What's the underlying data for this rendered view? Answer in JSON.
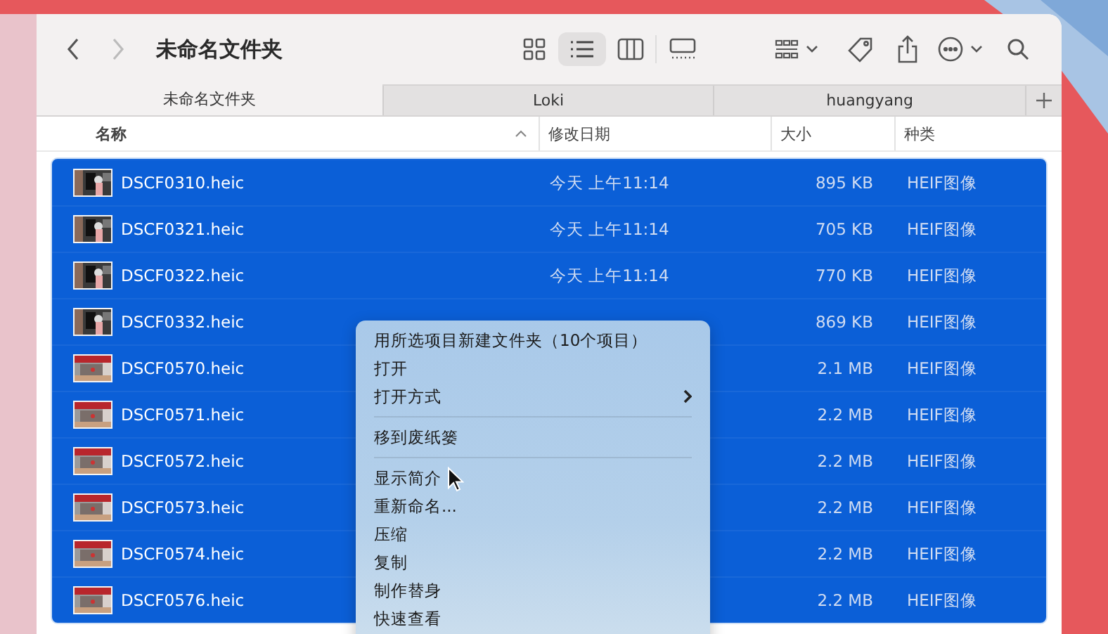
{
  "window": {
    "title": "未命名文件夹"
  },
  "navigation": {
    "back_disabled": false,
    "forward_disabled": true
  },
  "view_modes": [
    {
      "kind": "icons",
      "selected": false
    },
    {
      "kind": "list",
      "selected": true
    },
    {
      "kind": "columns",
      "selected": false
    },
    {
      "kind": "gallery",
      "selected": false
    }
  ],
  "tabs": [
    {
      "label": "未命名文件夹",
      "selected": true
    },
    {
      "label": "Loki",
      "selected": false
    },
    {
      "label": "huangyang",
      "selected": false
    }
  ],
  "columns": [
    {
      "label": "名称",
      "sorted": true
    },
    {
      "label": "修改日期",
      "sorted": false
    },
    {
      "label": "大小",
      "sorted": false
    },
    {
      "label": "种类",
      "sorted": false
    }
  ],
  "rows": [
    {
      "name": "DSCF0310.heic",
      "date": "今天 上午11:14",
      "size": "895 KB",
      "kind": "HEIF图像",
      "selected": true
    },
    {
      "name": "DSCF0321.heic",
      "date": "今天 上午11:14",
      "size": "705 KB",
      "kind": "HEIF图像",
      "selected": true
    },
    {
      "name": "DSCF0322.heic",
      "date": "今天 上午11:14",
      "size": "770 KB",
      "kind": "HEIF图像",
      "selected": true
    },
    {
      "name": "DSCF0332.heic",
      "size": "869 KB",
      "kind": "HEIF图像",
      "selected": true
    },
    {
      "name": "DSCF0570.heic",
      "size": "2.1 MB",
      "kind": "HEIF图像",
      "selected": true
    },
    {
      "name": "DSCF0571.heic",
      "size": "2.2 MB",
      "kind": "HEIF图像",
      "selected": true
    },
    {
      "name": "DSCF0572.heic",
      "size": "2.2 MB",
      "kind": "HEIF图像",
      "selected": true
    },
    {
      "name": "DSCF0573.heic",
      "size": "2.2 MB",
      "kind": "HEIF图像",
      "selected": true
    },
    {
      "name": "DSCF0574.heic",
      "size": "2.2 MB",
      "kind": "HEIF图像",
      "selected": true
    },
    {
      "name": "DSCF0576.heic",
      "size": "2.2 MB",
      "kind": "HEIF图像",
      "selected": true
    }
  ],
  "context_menu": {
    "items": [
      {
        "kind": "item",
        "label": "用所选项目新建文件夹（10个项目）",
        "submenu": false
      },
      {
        "kind": "item",
        "label": "打开",
        "submenu": false
      },
      {
        "kind": "item",
        "label": "打开方式",
        "submenu": true
      },
      {
        "kind": "separator"
      },
      {
        "kind": "item",
        "label": "移到废纸篓",
        "submenu": false
      },
      {
        "kind": "separator"
      },
      {
        "kind": "item",
        "label": "显示简介",
        "submenu": false
      },
      {
        "kind": "item",
        "label": "重新命名...",
        "submenu": false
      },
      {
        "kind": "item",
        "label": "压缩",
        "submenu": false
      },
      {
        "kind": "item",
        "label": "复制",
        "submenu": false
      },
      {
        "kind": "item",
        "label": "制作替身",
        "submenu": false
      },
      {
        "kind": "item",
        "label": "快速查看",
        "submenu": false
      }
    ]
  }
}
